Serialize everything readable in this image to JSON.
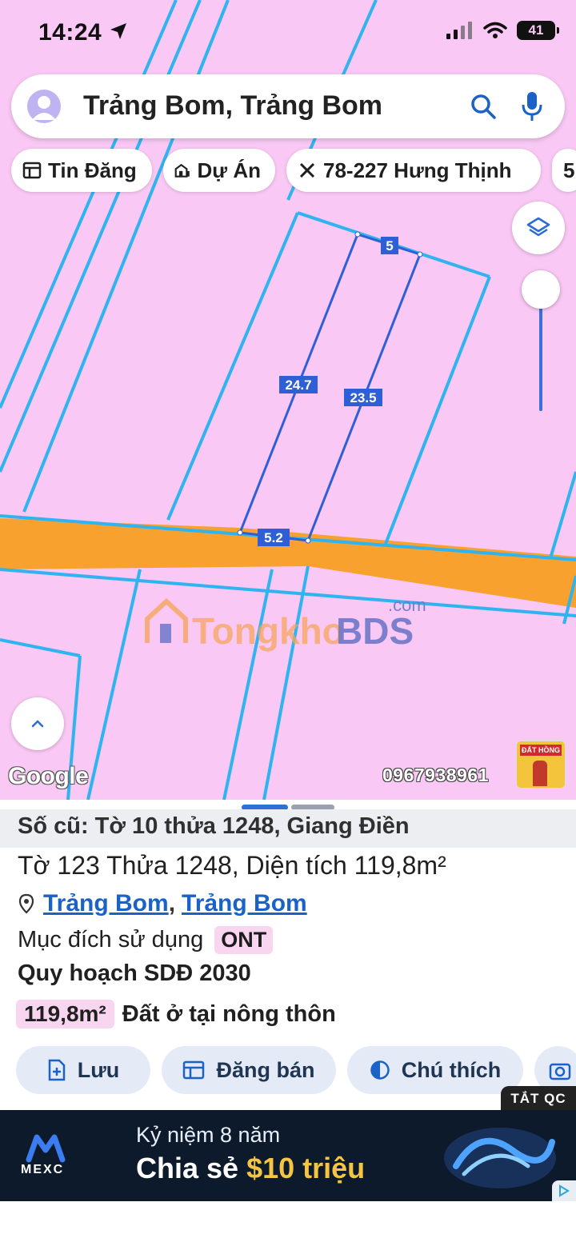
{
  "status_bar": {
    "time": "14:24",
    "battery": "41"
  },
  "search": {
    "query": "Trảng Bom, Trảng Bom"
  },
  "chips": [
    {
      "label": "Tin Đăng",
      "icon": "listing-icon"
    },
    {
      "label": "Dự Án",
      "icon": "project-building-icon"
    },
    {
      "label": "78-227 Hưng Thịnh",
      "icon": "ruler-tools-icon"
    },
    {
      "label": "5",
      "icon": ""
    }
  ],
  "map": {
    "labels": {
      "top_edge": "5",
      "left_edge": "24.7",
      "right_edge": "23.5",
      "bottom_edge": "5.2"
    },
    "watermark": {
      "brand1": "Tongkho",
      "brand2": "BDS",
      "suffix": ".com"
    },
    "google": "Google",
    "phone": "0967938961",
    "shop_sign": "ĐẤT HỒNG",
    "colors": {
      "land": "#f9c8f4",
      "road": "#f8a12e",
      "lines": "#2fb4f0",
      "selected": "#2f5fd6"
    }
  },
  "sheet": {
    "old_info": "Số cũ: Tờ 10 thửa 1248, Giang Điền",
    "title": "Tờ 123 Thửa 1248, Diện tích 119,8m²",
    "address_part1": "Trảng Bom",
    "address_sep": ",",
    "address_part2": "Trảng Bom",
    "purpose_label": "Mục đích sử dụng",
    "purpose_code": "ONT",
    "plan_label": "Quy hoạch SDĐ 2030",
    "area_value": "119,8m²",
    "area_desc": "Đất ở tại nông thôn"
  },
  "actions": [
    {
      "label": "Lưu",
      "icon": "save-plus-icon"
    },
    {
      "label": "Đăng bán",
      "icon": "post-sale-icon"
    },
    {
      "label": "Chú thích",
      "icon": "legend-contrast-icon"
    },
    {
      "label": "",
      "icon": "add-photo-icon"
    }
  ],
  "ad": {
    "close_label": "TẮT QC",
    "brand": "MEXC",
    "line1": "Kỷ niệm 8 năm",
    "line2_prefix": "Chia sẻ ",
    "line2_amount": "$10 triệu"
  }
}
